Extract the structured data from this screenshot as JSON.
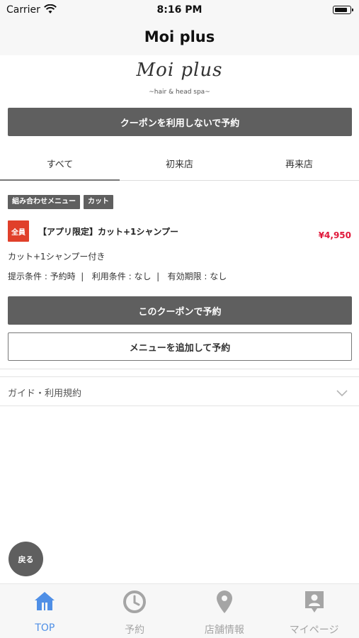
{
  "status_bar": {
    "carrier": "Carrier",
    "time": "8:16 PM"
  },
  "nav": {
    "title": "Moi plus"
  },
  "logo": {
    "main": "Moi plus",
    "sub": "~hair & head spa~"
  },
  "book_without_coupon": "クーポンを利用しないで予約",
  "tabs": [
    {
      "label": "すべて",
      "active": true
    },
    {
      "label": "初来店",
      "active": false
    },
    {
      "label": "再来店",
      "active": false
    }
  ],
  "coupon": {
    "tags": [
      "組み合わせメニュー",
      "カット"
    ],
    "badge": "全員",
    "title": "【アプリ限定】カット+1シャンプー",
    "price": "¥4,950",
    "description": "カット+1シャンプー付き",
    "conditions": "提示条件 : 予約時  |   利用条件 : なし  |   有効期限 : なし",
    "use_button": "このクーポンで予約",
    "add_menu_button": "メニューを追加して予約"
  },
  "guide": {
    "label": "ガイド・利用規約"
  },
  "back_button": "戻る",
  "tabbar": [
    {
      "label": "TOP",
      "icon": "home-icon",
      "active": true
    },
    {
      "label": "予約",
      "icon": "clock-icon",
      "active": false
    },
    {
      "label": "店舗情報",
      "icon": "map-pin-icon",
      "active": false
    },
    {
      "label": "マイページ",
      "icon": "person-badge-icon",
      "active": false
    }
  ],
  "colors": {
    "accent_blue": "#4f8fe6",
    "button_dark": "#5f5f5f",
    "price_red": "#e0183a",
    "badge_red": "#e0402a"
  }
}
